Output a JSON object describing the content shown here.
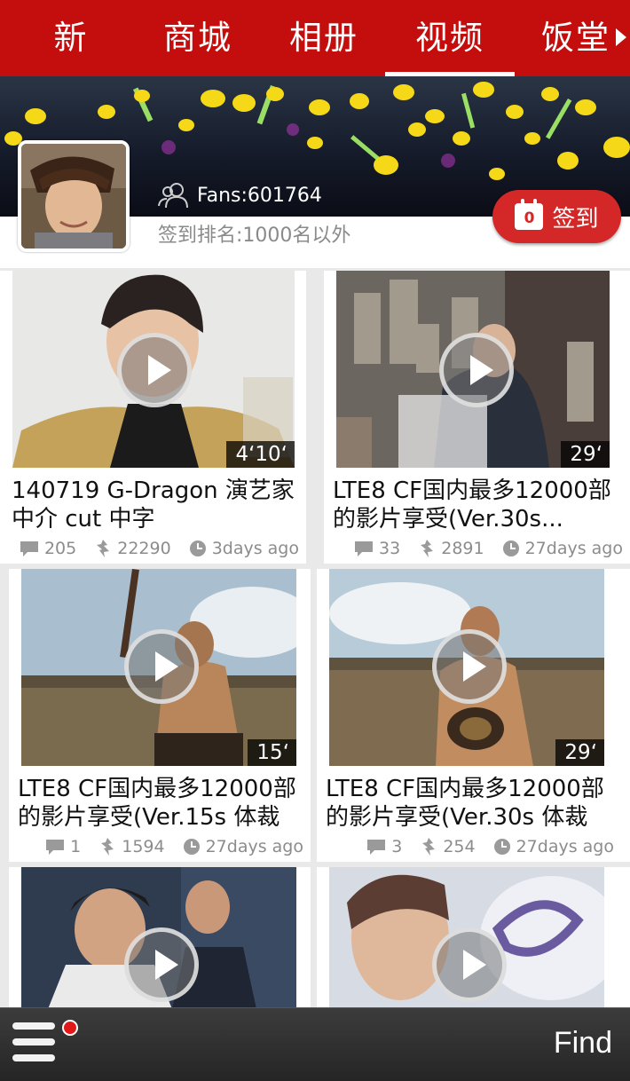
{
  "nav": {
    "tabs": [
      {
        "label": "新闻"
      },
      {
        "label": "商城"
      },
      {
        "label": "相册"
      },
      {
        "label": "视频",
        "active": true
      },
      {
        "label": "饭堂"
      }
    ]
  },
  "profile": {
    "fans": "Fans:601764",
    "rank": "签到排名:1000名以外",
    "checkin_label": "签到",
    "checkin_day": "0"
  },
  "videos": [
    {
      "title_line1": "140719 G-Dragon 演艺家",
      "title_line2": "中介 cut 中字",
      "duration": "4‘10‘",
      "comments": "205",
      "views": "22290",
      "time": "3days ago"
    },
    {
      "title_line1": "LTE8 CF国内最多12000部",
      "title_line2": "的影片享受(Ver.30s...",
      "duration": "29‘",
      "comments": "33",
      "views": "2891",
      "time": "27days ago"
    },
    {
      "title_line1": "LTE8 CF国内最多12000部",
      "title_line2": "的影片享受(Ver.15s 体裁",
      "duration": "15‘",
      "comments": "1",
      "views": "1594",
      "time": "27days ago"
    },
    {
      "title_line1": "LTE8 CF国内最多12000部",
      "title_line2": "的影片享受(Ver.30s 体裁",
      "duration": "29‘",
      "comments": "3",
      "views": "254",
      "time": "27days ago"
    },
    {
      "title_line1": "",
      "title_line2": "",
      "duration": "",
      "comments": "",
      "views": "",
      "time": ""
    },
    {
      "title_line1": "",
      "title_line2": "",
      "duration": "",
      "comments": "",
      "views": "",
      "time": ""
    }
  ],
  "bottom": {
    "find_label": "Find"
  },
  "colors": {
    "brand_red": "#c40d0d",
    "checkin_red": "#d42727",
    "meta_gray": "#8c8c8c"
  }
}
